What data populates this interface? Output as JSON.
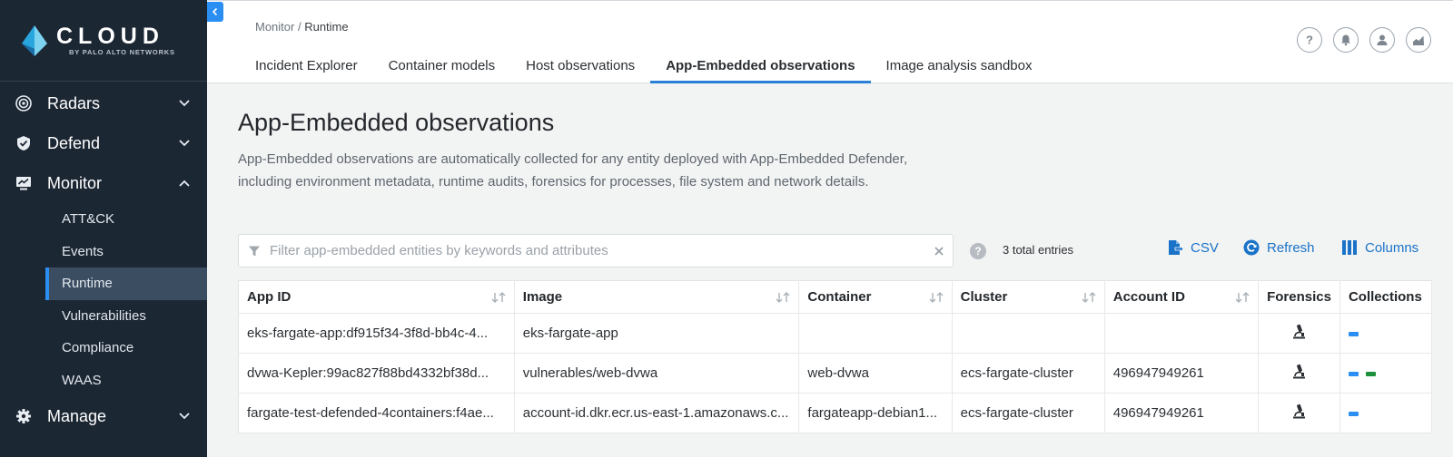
{
  "brand": {
    "title": "CLOUD",
    "subtitle": "BY PALO ALTO NETWORKS"
  },
  "sidebar": {
    "groups": [
      {
        "label": "Radars",
        "icon": "radar-icon",
        "expanded": false
      },
      {
        "label": "Defend",
        "icon": "shield-icon",
        "expanded": false
      },
      {
        "label": "Monitor",
        "icon": "monitor-icon",
        "expanded": true,
        "items": [
          "ATT&CK",
          "Events",
          "Runtime",
          "Vulnerabilities",
          "Compliance",
          "WAAS"
        ],
        "active_item": "Runtime"
      },
      {
        "label": "Manage",
        "icon": "gear-icon",
        "expanded": false
      }
    ]
  },
  "breadcrumb": {
    "parent": "Monitor",
    "separator": " / ",
    "current": "Runtime"
  },
  "tabs": [
    {
      "label": "Incident Explorer"
    },
    {
      "label": "Container models"
    },
    {
      "label": "Host observations"
    },
    {
      "label": "App-Embedded observations",
      "active": true
    },
    {
      "label": "Image analysis sandbox"
    }
  ],
  "header_icons": [
    "help-icon",
    "bell-icon",
    "user-icon",
    "chart-icon"
  ],
  "page": {
    "title": "App-Embedded observations",
    "description_line1": "App-Embedded observations are automatically collected for any entity deployed with App-Embedded Defender,",
    "description_line2": "including environment metadata, runtime audits, forensics for processes, file system and network details."
  },
  "filter": {
    "placeholder": "Filter app-embedded entities by keywords and attributes",
    "value": ""
  },
  "total_entries": "3 total entries",
  "actions": {
    "csv": "CSV",
    "refresh": "Refresh",
    "columns": "Columns"
  },
  "colors": {
    "accent": "#1a73c8",
    "sidebar_bg": "#1c2734",
    "collection_blue": "#2a8ef2",
    "collection_green": "#1e8f3c"
  },
  "table": {
    "columns": [
      "App ID",
      "Image",
      "Container",
      "Cluster",
      "Account ID",
      "Forensics",
      "Collections"
    ],
    "rows": [
      {
        "app_id": "eks-fargate-app:df915f34-3f8d-bb4c-4...",
        "image": "eks-fargate-app",
        "container": "",
        "cluster": "",
        "account_id": "",
        "collections": [
          "blue"
        ]
      },
      {
        "app_id": "dvwa-Kepler:99ac827f88bd4332bf38d...",
        "image": "vulnerables/web-dvwa",
        "container": "web-dvwa",
        "cluster": "ecs-fargate-cluster",
        "account_id": "496947949261",
        "collections": [
          "blue",
          "green"
        ]
      },
      {
        "app_id": "fargate-test-defended-4containers:f4ae...",
        "image": "account-id.dkr.ecr.us-east-1.amazonaws.c...",
        "container": "fargateapp-debian1...",
        "cluster": "ecs-fargate-cluster",
        "account_id": "496947949261",
        "collections": [
          "blue"
        ]
      }
    ]
  }
}
